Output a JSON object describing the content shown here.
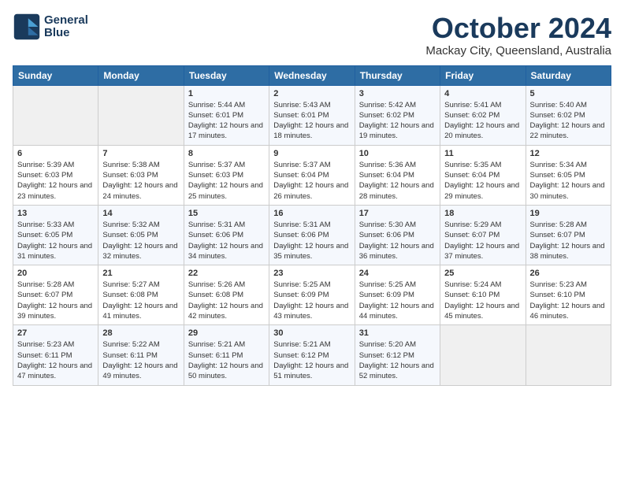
{
  "header": {
    "logo_line1": "General",
    "logo_line2": "Blue",
    "month": "October 2024",
    "location": "Mackay City, Queensland, Australia"
  },
  "days_of_week": [
    "Sunday",
    "Monday",
    "Tuesday",
    "Wednesday",
    "Thursday",
    "Friday",
    "Saturday"
  ],
  "weeks": [
    [
      {
        "day": "",
        "info": ""
      },
      {
        "day": "",
        "info": ""
      },
      {
        "day": "1",
        "info": "Sunrise: 5:44 AM\nSunset: 6:01 PM\nDaylight: 12 hours and 17 minutes."
      },
      {
        "day": "2",
        "info": "Sunrise: 5:43 AM\nSunset: 6:01 PM\nDaylight: 12 hours and 18 minutes."
      },
      {
        "day": "3",
        "info": "Sunrise: 5:42 AM\nSunset: 6:02 PM\nDaylight: 12 hours and 19 minutes."
      },
      {
        "day": "4",
        "info": "Sunrise: 5:41 AM\nSunset: 6:02 PM\nDaylight: 12 hours and 20 minutes."
      },
      {
        "day": "5",
        "info": "Sunrise: 5:40 AM\nSunset: 6:02 PM\nDaylight: 12 hours and 22 minutes."
      }
    ],
    [
      {
        "day": "6",
        "info": "Sunrise: 5:39 AM\nSunset: 6:03 PM\nDaylight: 12 hours and 23 minutes."
      },
      {
        "day": "7",
        "info": "Sunrise: 5:38 AM\nSunset: 6:03 PM\nDaylight: 12 hours and 24 minutes."
      },
      {
        "day": "8",
        "info": "Sunrise: 5:37 AM\nSunset: 6:03 PM\nDaylight: 12 hours and 25 minutes."
      },
      {
        "day": "9",
        "info": "Sunrise: 5:37 AM\nSunset: 6:04 PM\nDaylight: 12 hours and 26 minutes."
      },
      {
        "day": "10",
        "info": "Sunrise: 5:36 AM\nSunset: 6:04 PM\nDaylight: 12 hours and 28 minutes."
      },
      {
        "day": "11",
        "info": "Sunrise: 5:35 AM\nSunset: 6:04 PM\nDaylight: 12 hours and 29 minutes."
      },
      {
        "day": "12",
        "info": "Sunrise: 5:34 AM\nSunset: 6:05 PM\nDaylight: 12 hours and 30 minutes."
      }
    ],
    [
      {
        "day": "13",
        "info": "Sunrise: 5:33 AM\nSunset: 6:05 PM\nDaylight: 12 hours and 31 minutes."
      },
      {
        "day": "14",
        "info": "Sunrise: 5:32 AM\nSunset: 6:05 PM\nDaylight: 12 hours and 32 minutes."
      },
      {
        "day": "15",
        "info": "Sunrise: 5:31 AM\nSunset: 6:06 PM\nDaylight: 12 hours and 34 minutes."
      },
      {
        "day": "16",
        "info": "Sunrise: 5:31 AM\nSunset: 6:06 PM\nDaylight: 12 hours and 35 minutes."
      },
      {
        "day": "17",
        "info": "Sunrise: 5:30 AM\nSunset: 6:06 PM\nDaylight: 12 hours and 36 minutes."
      },
      {
        "day": "18",
        "info": "Sunrise: 5:29 AM\nSunset: 6:07 PM\nDaylight: 12 hours and 37 minutes."
      },
      {
        "day": "19",
        "info": "Sunrise: 5:28 AM\nSunset: 6:07 PM\nDaylight: 12 hours and 38 minutes."
      }
    ],
    [
      {
        "day": "20",
        "info": "Sunrise: 5:28 AM\nSunset: 6:07 PM\nDaylight: 12 hours and 39 minutes."
      },
      {
        "day": "21",
        "info": "Sunrise: 5:27 AM\nSunset: 6:08 PM\nDaylight: 12 hours and 41 minutes."
      },
      {
        "day": "22",
        "info": "Sunrise: 5:26 AM\nSunset: 6:08 PM\nDaylight: 12 hours and 42 minutes."
      },
      {
        "day": "23",
        "info": "Sunrise: 5:25 AM\nSunset: 6:09 PM\nDaylight: 12 hours and 43 minutes."
      },
      {
        "day": "24",
        "info": "Sunrise: 5:25 AM\nSunset: 6:09 PM\nDaylight: 12 hours and 44 minutes."
      },
      {
        "day": "25",
        "info": "Sunrise: 5:24 AM\nSunset: 6:10 PM\nDaylight: 12 hours and 45 minutes."
      },
      {
        "day": "26",
        "info": "Sunrise: 5:23 AM\nSunset: 6:10 PM\nDaylight: 12 hours and 46 minutes."
      }
    ],
    [
      {
        "day": "27",
        "info": "Sunrise: 5:23 AM\nSunset: 6:11 PM\nDaylight: 12 hours and 47 minutes."
      },
      {
        "day": "28",
        "info": "Sunrise: 5:22 AM\nSunset: 6:11 PM\nDaylight: 12 hours and 49 minutes."
      },
      {
        "day": "29",
        "info": "Sunrise: 5:21 AM\nSunset: 6:11 PM\nDaylight: 12 hours and 50 minutes."
      },
      {
        "day": "30",
        "info": "Sunrise: 5:21 AM\nSunset: 6:12 PM\nDaylight: 12 hours and 51 minutes."
      },
      {
        "day": "31",
        "info": "Sunrise: 5:20 AM\nSunset: 6:12 PM\nDaylight: 12 hours and 52 minutes."
      },
      {
        "day": "",
        "info": ""
      },
      {
        "day": "",
        "info": ""
      }
    ]
  ]
}
